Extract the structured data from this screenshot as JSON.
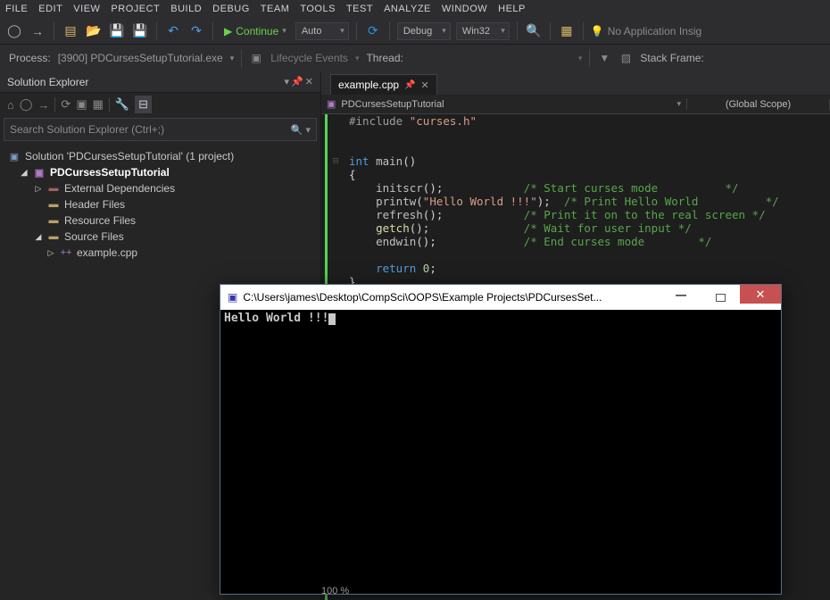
{
  "menu": [
    "FILE",
    "EDIT",
    "VIEW",
    "PROJECT",
    "BUILD",
    "DEBUG",
    "TEAM",
    "TOOLS",
    "TEST",
    "ANALYZE",
    "WINDOW",
    "HELP"
  ],
  "toolbar": {
    "continue_label": "Continue",
    "combo1": "Auto",
    "combo2": "Debug",
    "combo3": "Win32",
    "noapp": "No Application Insig"
  },
  "toolbar2": {
    "process_label": "Process:",
    "process_name": "[3900] PDCursesSetupTutorial.exe",
    "lifecycle": "Lifecycle Events",
    "thread": "Thread:",
    "stackframe": "Stack Frame:"
  },
  "explorer": {
    "title": "Solution Explorer",
    "search_placeholder": "Search Solution Explorer (Ctrl+;)",
    "tree": {
      "solution": "Solution 'PDCursesSetupTutorial' (1 project)",
      "project": "PDCursesSetupTutorial",
      "external": "External Dependencies",
      "header": "Header Files",
      "resource": "Resource Files",
      "source": "Source Files",
      "example": "example.cpp"
    }
  },
  "editor": {
    "tab_name": "example.cpp",
    "nav_left": "PDCursesSetupTutorial",
    "nav_right": "(Global Scope)"
  },
  "code": {
    "include_kw": "#include",
    "include_str": "\"curses.h\"",
    "int": "int",
    "main": "main",
    "initscr": "initscr",
    "c1": "/* Start curses mode          */",
    "printw": "printw",
    "hello": "\"Hello World !!!\"",
    "c2": "/* Print Hello World          */",
    "refresh": "refresh",
    "c3": "/* Print it on to the real screen */",
    "getch": "getch",
    "c4": "/* Wait for user input */",
    "endwin": "endwin",
    "c5": "/* End curses mode        */",
    "return": "return",
    "zero": "0"
  },
  "console": {
    "title": "C:\\Users\\james\\Desktop\\CompSci\\OOPS\\Example Projects\\PDCursesSet...",
    "output": "Hello World !!!"
  },
  "status": {
    "zoom": "100 %"
  }
}
